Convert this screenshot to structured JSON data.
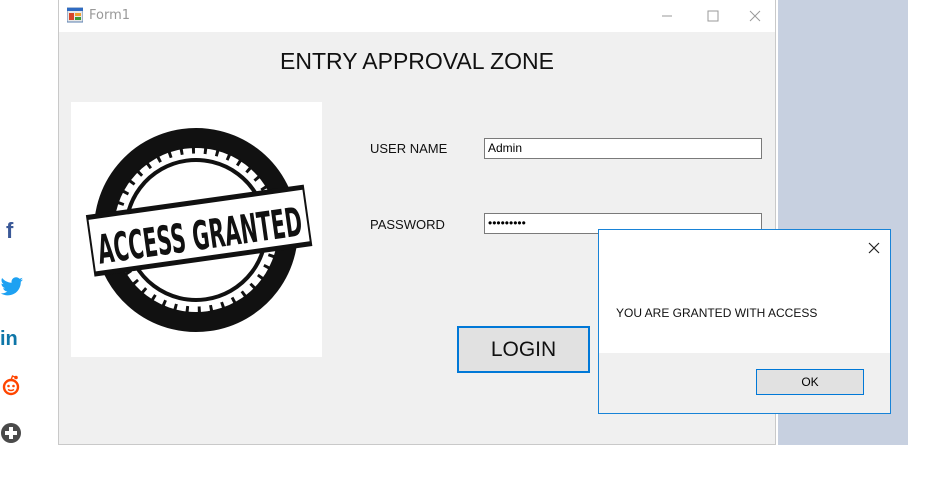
{
  "window": {
    "title": "Form1",
    "heading": "ENTRY APPROVAL ZONE",
    "image_text": "ACCESS GRANTED"
  },
  "form": {
    "username_label": "USER NAME",
    "username_value": "Admin",
    "password_label": "PASSWORD",
    "password_value": "•••••••••",
    "login_label": "LOGIN"
  },
  "dialog": {
    "message": "YOU ARE GRANTED WITH ACCESS",
    "ok_label": "OK"
  },
  "social": {
    "facebook": "f",
    "linkedin": "in"
  },
  "colors": {
    "accent": "#0078d7",
    "form_bg": "#f0f0f0",
    "backdrop": "#c7d0e0"
  }
}
